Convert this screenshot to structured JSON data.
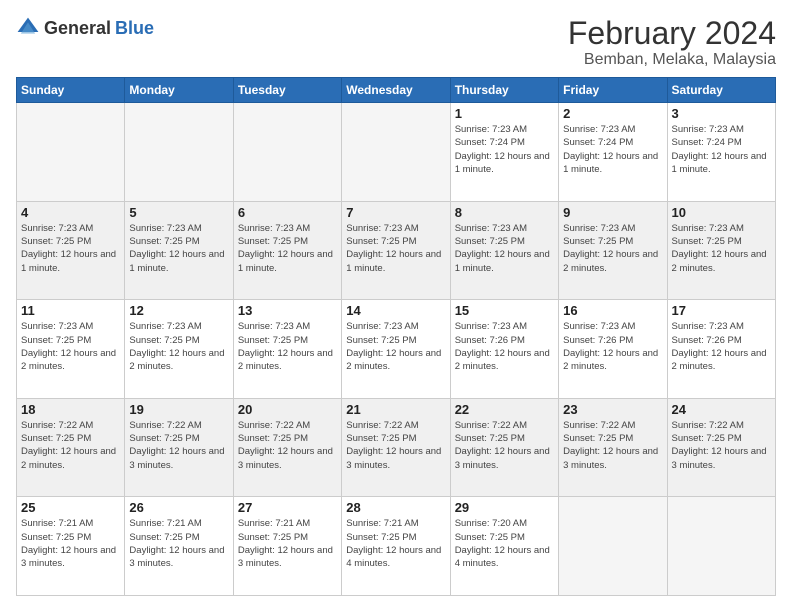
{
  "header": {
    "logo_general": "General",
    "logo_blue": "Blue",
    "title": "February 2024",
    "subtitle": "Bemban, Melaka, Malaysia"
  },
  "days_of_week": [
    "Sunday",
    "Monday",
    "Tuesday",
    "Wednesday",
    "Thursday",
    "Friday",
    "Saturday"
  ],
  "weeks": [
    [
      {
        "day": "",
        "sunrise": "",
        "sunset": "",
        "daylight": "",
        "empty": true
      },
      {
        "day": "",
        "sunrise": "",
        "sunset": "",
        "daylight": "",
        "empty": true
      },
      {
        "day": "",
        "sunrise": "",
        "sunset": "",
        "daylight": "",
        "empty": true
      },
      {
        "day": "",
        "sunrise": "",
        "sunset": "",
        "daylight": "",
        "empty": true
      },
      {
        "day": "1",
        "sunrise": "Sunrise: 7:23 AM",
        "sunset": "Sunset: 7:24 PM",
        "daylight": "Daylight: 12 hours and 1 minute.",
        "empty": false
      },
      {
        "day": "2",
        "sunrise": "Sunrise: 7:23 AM",
        "sunset": "Sunset: 7:24 PM",
        "daylight": "Daylight: 12 hours and 1 minute.",
        "empty": false
      },
      {
        "day": "3",
        "sunrise": "Sunrise: 7:23 AM",
        "sunset": "Sunset: 7:24 PM",
        "daylight": "Daylight: 12 hours and 1 minute.",
        "empty": false
      }
    ],
    [
      {
        "day": "4",
        "sunrise": "Sunrise: 7:23 AM",
        "sunset": "Sunset: 7:25 PM",
        "daylight": "Daylight: 12 hours and 1 minute.",
        "empty": false
      },
      {
        "day": "5",
        "sunrise": "Sunrise: 7:23 AM",
        "sunset": "Sunset: 7:25 PM",
        "daylight": "Daylight: 12 hours and 1 minute.",
        "empty": false
      },
      {
        "day": "6",
        "sunrise": "Sunrise: 7:23 AM",
        "sunset": "Sunset: 7:25 PM",
        "daylight": "Daylight: 12 hours and 1 minute.",
        "empty": false
      },
      {
        "day": "7",
        "sunrise": "Sunrise: 7:23 AM",
        "sunset": "Sunset: 7:25 PM",
        "daylight": "Daylight: 12 hours and 1 minute.",
        "empty": false
      },
      {
        "day": "8",
        "sunrise": "Sunrise: 7:23 AM",
        "sunset": "Sunset: 7:25 PM",
        "daylight": "Daylight: 12 hours and 1 minute.",
        "empty": false
      },
      {
        "day": "9",
        "sunrise": "Sunrise: 7:23 AM",
        "sunset": "Sunset: 7:25 PM",
        "daylight": "Daylight: 12 hours and 2 minutes.",
        "empty": false
      },
      {
        "day": "10",
        "sunrise": "Sunrise: 7:23 AM",
        "sunset": "Sunset: 7:25 PM",
        "daylight": "Daylight: 12 hours and 2 minutes.",
        "empty": false
      }
    ],
    [
      {
        "day": "11",
        "sunrise": "Sunrise: 7:23 AM",
        "sunset": "Sunset: 7:25 PM",
        "daylight": "Daylight: 12 hours and 2 minutes.",
        "empty": false
      },
      {
        "day": "12",
        "sunrise": "Sunrise: 7:23 AM",
        "sunset": "Sunset: 7:25 PM",
        "daylight": "Daylight: 12 hours and 2 minutes.",
        "empty": false
      },
      {
        "day": "13",
        "sunrise": "Sunrise: 7:23 AM",
        "sunset": "Sunset: 7:25 PM",
        "daylight": "Daylight: 12 hours and 2 minutes.",
        "empty": false
      },
      {
        "day": "14",
        "sunrise": "Sunrise: 7:23 AM",
        "sunset": "Sunset: 7:25 PM",
        "daylight": "Daylight: 12 hours and 2 minutes.",
        "empty": false
      },
      {
        "day": "15",
        "sunrise": "Sunrise: 7:23 AM",
        "sunset": "Sunset: 7:26 PM",
        "daylight": "Daylight: 12 hours and 2 minutes.",
        "empty": false
      },
      {
        "day": "16",
        "sunrise": "Sunrise: 7:23 AM",
        "sunset": "Sunset: 7:26 PM",
        "daylight": "Daylight: 12 hours and 2 minutes.",
        "empty": false
      },
      {
        "day": "17",
        "sunrise": "Sunrise: 7:23 AM",
        "sunset": "Sunset: 7:26 PM",
        "daylight": "Daylight: 12 hours and 2 minutes.",
        "empty": false
      }
    ],
    [
      {
        "day": "18",
        "sunrise": "Sunrise: 7:22 AM",
        "sunset": "Sunset: 7:25 PM",
        "daylight": "Daylight: 12 hours and 2 minutes.",
        "empty": false
      },
      {
        "day": "19",
        "sunrise": "Sunrise: 7:22 AM",
        "sunset": "Sunset: 7:25 PM",
        "daylight": "Daylight: 12 hours and 3 minutes.",
        "empty": false
      },
      {
        "day": "20",
        "sunrise": "Sunrise: 7:22 AM",
        "sunset": "Sunset: 7:25 PM",
        "daylight": "Daylight: 12 hours and 3 minutes.",
        "empty": false
      },
      {
        "day": "21",
        "sunrise": "Sunrise: 7:22 AM",
        "sunset": "Sunset: 7:25 PM",
        "daylight": "Daylight: 12 hours and 3 minutes.",
        "empty": false
      },
      {
        "day": "22",
        "sunrise": "Sunrise: 7:22 AM",
        "sunset": "Sunset: 7:25 PM",
        "daylight": "Daylight: 12 hours and 3 minutes.",
        "empty": false
      },
      {
        "day": "23",
        "sunrise": "Sunrise: 7:22 AM",
        "sunset": "Sunset: 7:25 PM",
        "daylight": "Daylight: 12 hours and 3 minutes.",
        "empty": false
      },
      {
        "day": "24",
        "sunrise": "Sunrise: 7:22 AM",
        "sunset": "Sunset: 7:25 PM",
        "daylight": "Daylight: 12 hours and 3 minutes.",
        "empty": false
      }
    ],
    [
      {
        "day": "25",
        "sunrise": "Sunrise: 7:21 AM",
        "sunset": "Sunset: 7:25 PM",
        "daylight": "Daylight: 12 hours and 3 minutes.",
        "empty": false
      },
      {
        "day": "26",
        "sunrise": "Sunrise: 7:21 AM",
        "sunset": "Sunset: 7:25 PM",
        "daylight": "Daylight: 12 hours and 3 minutes.",
        "empty": false
      },
      {
        "day": "27",
        "sunrise": "Sunrise: 7:21 AM",
        "sunset": "Sunset: 7:25 PM",
        "daylight": "Daylight: 12 hours and 3 minutes.",
        "empty": false
      },
      {
        "day": "28",
        "sunrise": "Sunrise: 7:21 AM",
        "sunset": "Sunset: 7:25 PM",
        "daylight": "Daylight: 12 hours and 4 minutes.",
        "empty": false
      },
      {
        "day": "29",
        "sunrise": "Sunrise: 7:20 AM",
        "sunset": "Sunset: 7:25 PM",
        "daylight": "Daylight: 12 hours and 4 minutes.",
        "empty": false
      },
      {
        "day": "",
        "sunrise": "",
        "sunset": "",
        "daylight": "",
        "empty": true
      },
      {
        "day": "",
        "sunrise": "",
        "sunset": "",
        "daylight": "",
        "empty": true
      }
    ]
  ]
}
